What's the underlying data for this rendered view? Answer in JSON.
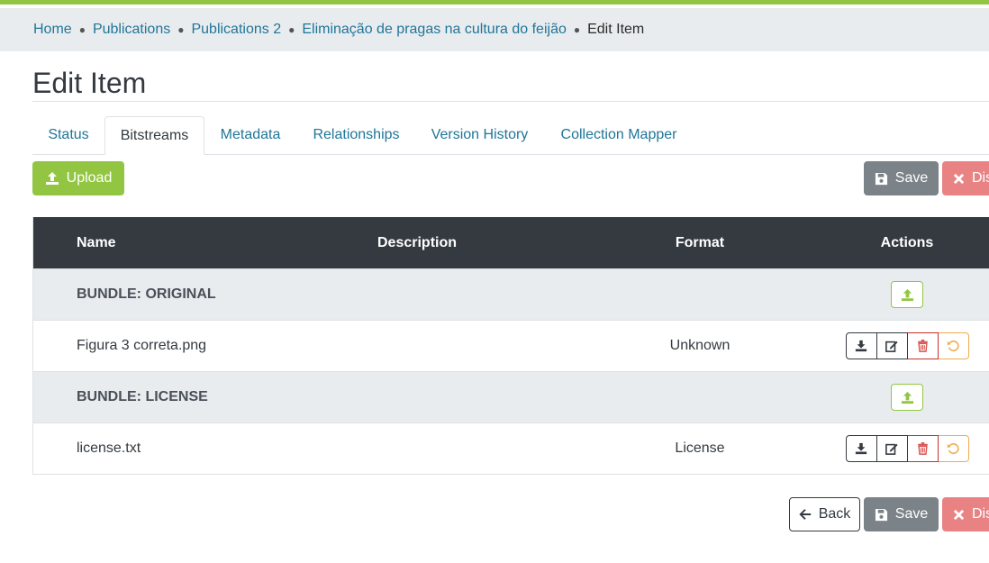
{
  "colors": {
    "brand_green": "#92c642",
    "link": "#207698",
    "dark": "#343a40",
    "danger": "#e98383",
    "secondary": "#7b8389"
  },
  "breadcrumb": {
    "items": [
      "Home",
      "Publications",
      "Publications 2",
      "Eliminação de pragas na cultura do feijão"
    ],
    "current": "Edit Item"
  },
  "page_title": "Edit Item",
  "tabs": [
    {
      "label": "Status"
    },
    {
      "label": "Bitstreams"
    },
    {
      "label": "Metadata"
    },
    {
      "label": "Relationships"
    },
    {
      "label": "Version History"
    },
    {
      "label": "Collection Mapper"
    }
  ],
  "active_tab": "Bitstreams",
  "buttons": {
    "upload": "Upload",
    "save": "Save",
    "discard": "Dis",
    "back": "Back"
  },
  "table": {
    "headers": {
      "name": "Name",
      "description": "Description",
      "format": "Format",
      "actions": "Actions"
    },
    "bundles": [
      {
        "label": "BUNDLE: ORIGINAL",
        "files": [
          {
            "name": "Figura 3 correta.png",
            "description": "",
            "format": "Unknown"
          }
        ]
      },
      {
        "label": "BUNDLE: LICENSE",
        "files": [
          {
            "name": "license.txt",
            "description": "",
            "format": "License"
          }
        ]
      }
    ]
  },
  "icons": {
    "upload": "upload-icon",
    "save": "floppy-disk-icon",
    "discard": "x-icon",
    "back": "arrow-left-icon",
    "download": "download-icon",
    "edit": "edit-icon",
    "delete": "trash-icon",
    "undo": "undo-icon"
  }
}
